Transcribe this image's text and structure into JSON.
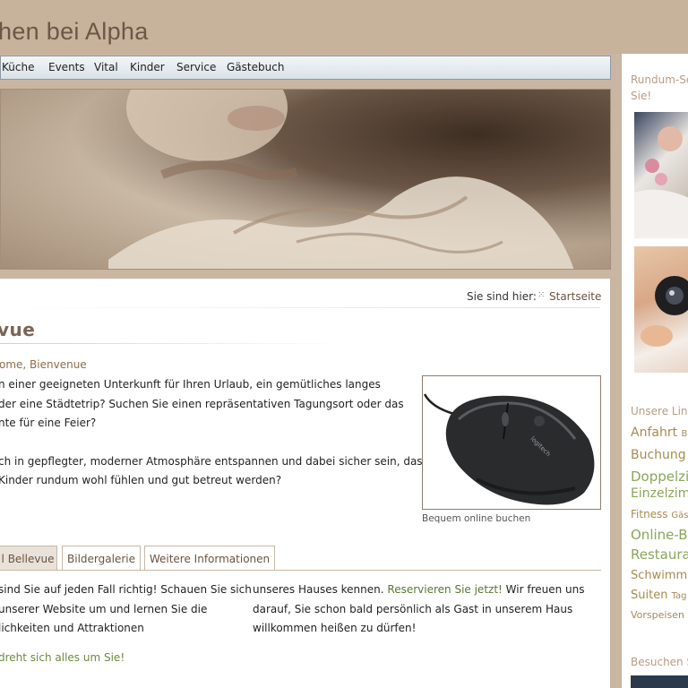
{
  "header": {
    "title": "hen bei Alpha"
  },
  "nav": {
    "items": [
      "Küche",
      "Events",
      "Vital",
      "Kinder",
      "Service",
      "Gästebuch"
    ]
  },
  "breadcrumb": {
    "label": "Sie sind hier:",
    "current": "Startseite"
  },
  "page": {
    "title": "vue",
    "subhead": "ome, Bienvenue",
    "intro_lines": [
      "n einer geeigneten Unterkunft für Ihren Urlaub, ein gemütliches langes",
      "der eine Städtetrip? Suchen Sie einen repräsentativen Tagungsort oder das",
      "nte für eine Feier?",
      "ch in gepflegter, moderner Atmosphäre entspannen und dabei sicher sein, dass",
      "Kinder rundum wohl fühlen und gut betreut werden?"
    ],
    "image_caption": "Bequem online buchen",
    "image_brand": "logitech"
  },
  "tabs": [
    "l Bellevue",
    "Bildergalerie",
    "Weitere Informationen"
  ],
  "body": {
    "left_lines": [
      "sind Sie auf jeden Fall richtig! Schauen Sie sich",
      "unserer Website um und lernen Sie die",
      "lichkeiten und Attraktionen"
    ],
    "right_line1_pre": "unseres Hauses kennen.",
    "right_line1_link": "Reservieren Sie jetzt!",
    "right_line1_post": "Wir freuen uns",
    "right_line2": "darauf, Sie schon bald persönlich als Gast in unserem Haus",
    "right_line3": "willkommen heißen zu dürfen!",
    "tagline": "dreht sich alles um Sie!"
  },
  "sidebar": {
    "heading1_line1": "Rundum-Se",
    "heading1_line2": "Sie!",
    "heading2": "Unsere Lin",
    "links": [
      {
        "text": "Anfahrt",
        "small": "Ba"
      },
      {
        "text": "Buchung O",
        "small": ""
      },
      {
        "text": "Doppelzin",
        "small": ""
      },
      {
        "text": "Einzelzimn",
        "small": ""
      },
      {
        "text": "Fitness",
        "small": "Gäst"
      },
      {
        "text": "Online-Bu",
        "small": ""
      },
      {
        "text": "Restaura",
        "small": ""
      },
      {
        "text": "Schwimmb",
        "small": ""
      },
      {
        "text": "Suiten",
        "small": "Tag"
      },
      {
        "text": "Vorspeisen",
        "small": ""
      }
    ],
    "heading3": "Besuchen S"
  }
}
